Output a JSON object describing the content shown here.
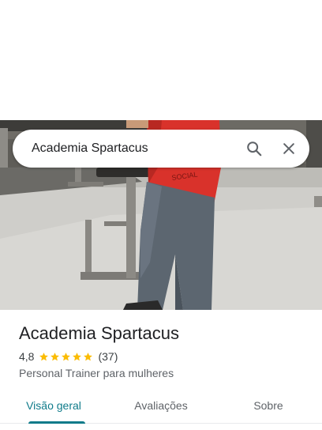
{
  "search": {
    "query": "Academia Spartacus"
  },
  "place": {
    "name": "Academia Spartacus",
    "rating": "4,8",
    "stars": 5,
    "reviews": "(37)",
    "category": "Personal Trainer para mulheres"
  },
  "tabs": [
    {
      "label": "Visão geral",
      "active": true
    },
    {
      "label": "Avaliações",
      "active": false
    },
    {
      "label": "Sobre",
      "active": false
    }
  ],
  "colors": {
    "accent": "#0f7b8a",
    "star": "#fbbc04"
  },
  "photo": {
    "shirt_text": "SOCIAL"
  }
}
